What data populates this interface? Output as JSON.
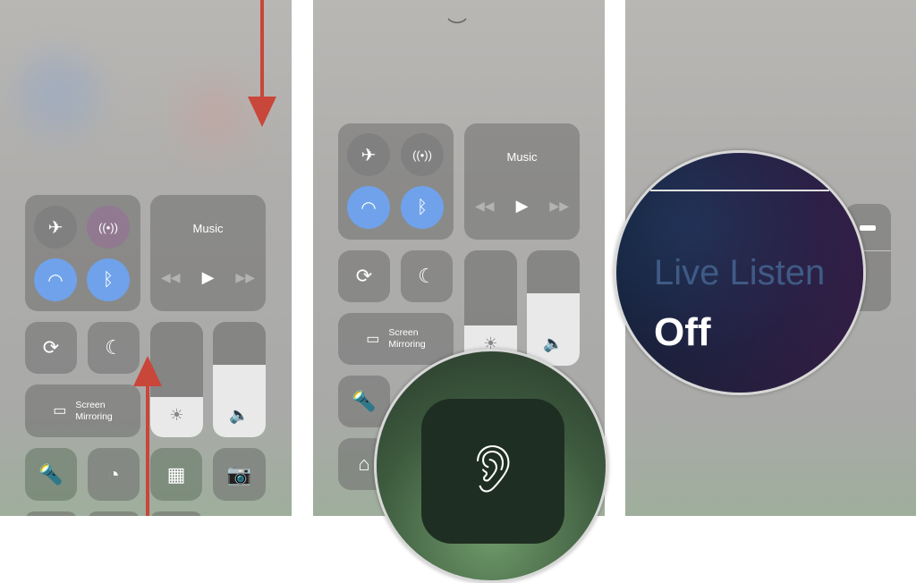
{
  "panels": [
    {
      "music": {
        "title": "Music"
      },
      "screen_mirroring": {
        "line1": "Screen",
        "line2": "Mirroring"
      },
      "brightness_level": 0.35,
      "volume_level": 0.63
    },
    {
      "music": {
        "title": "Music"
      },
      "screen_mirroring": {
        "line1": "Screen",
        "line2": "Mirroring"
      },
      "volume_level": 0.63
    },
    {
      "live_listen": {
        "label": "Live Listen",
        "status": "Off"
      }
    }
  ],
  "colors": {
    "accent": "#6fa2ea",
    "arrow": "#c9463a",
    "hearing_tile": "#1f2e22"
  },
  "icons": [
    "airplane-icon",
    "cellular-icon",
    "wifi-icon",
    "bluetooth-icon",
    "rotation-lock-icon",
    "moon-icon",
    "brightness-icon",
    "volume-icon",
    "screen-mirroring-icon",
    "flashlight-icon",
    "timer-icon",
    "calculator-icon",
    "camera-icon",
    "home-icon",
    "ear-icon",
    "chevron-down-icon"
  ]
}
